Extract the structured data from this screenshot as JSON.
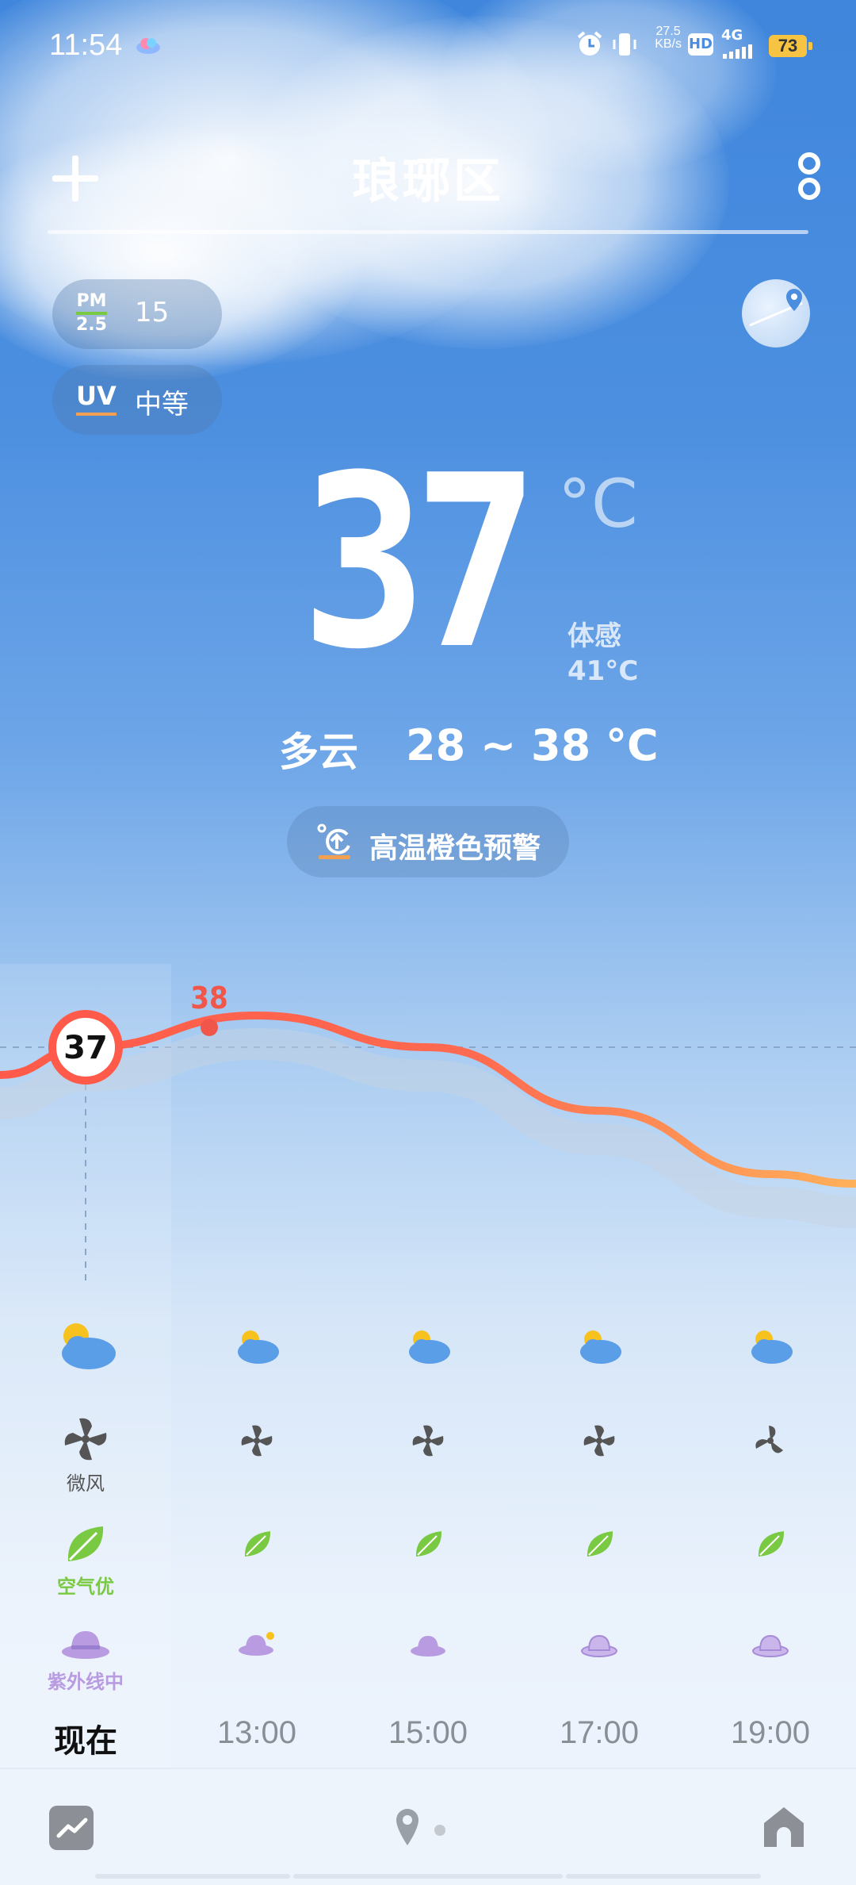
{
  "status_bar": {
    "time": "11:54",
    "net_speed_top": "27.5",
    "net_speed_bottom": "KB/s",
    "hd": "HD",
    "network": "4G",
    "battery": "73"
  },
  "header": {
    "city": "琅琊区"
  },
  "air": {
    "pm_label_top": "PM",
    "pm_label_bottom": "2.5",
    "pm_value": "15",
    "uv_label": "UV",
    "uv_value": "中等"
  },
  "current": {
    "temp": "37",
    "unit": "°C",
    "feels_label": "体感",
    "feels_value": "41°C",
    "condition": "多云",
    "range": "28 ~ 38 °C"
  },
  "alert": {
    "text": "高温橙色预警"
  },
  "chart_data": {
    "type": "line",
    "x": [
      "现在",
      "13:00",
      "15:00",
      "17:00",
      "19:00"
    ],
    "values": [
      37,
      38,
      37,
      35,
      33
    ],
    "current_label": "37",
    "max_label": "38",
    "reference_line": 37
  },
  "hourly": [
    {
      "time": "现在",
      "wind": "微风",
      "air": "空气优",
      "uv": "紫外线中"
    },
    {
      "time": "13:00"
    },
    {
      "time": "15:00"
    },
    {
      "time": "17:00"
    },
    {
      "time": "19:00"
    }
  ],
  "colors": {
    "temp_line_start": "#ff5a4a",
    "temp_line_end": "#ffb05a",
    "max_label": "#f0574a",
    "air_good": "#7ac943",
    "uv_purple": "#b89be0"
  }
}
